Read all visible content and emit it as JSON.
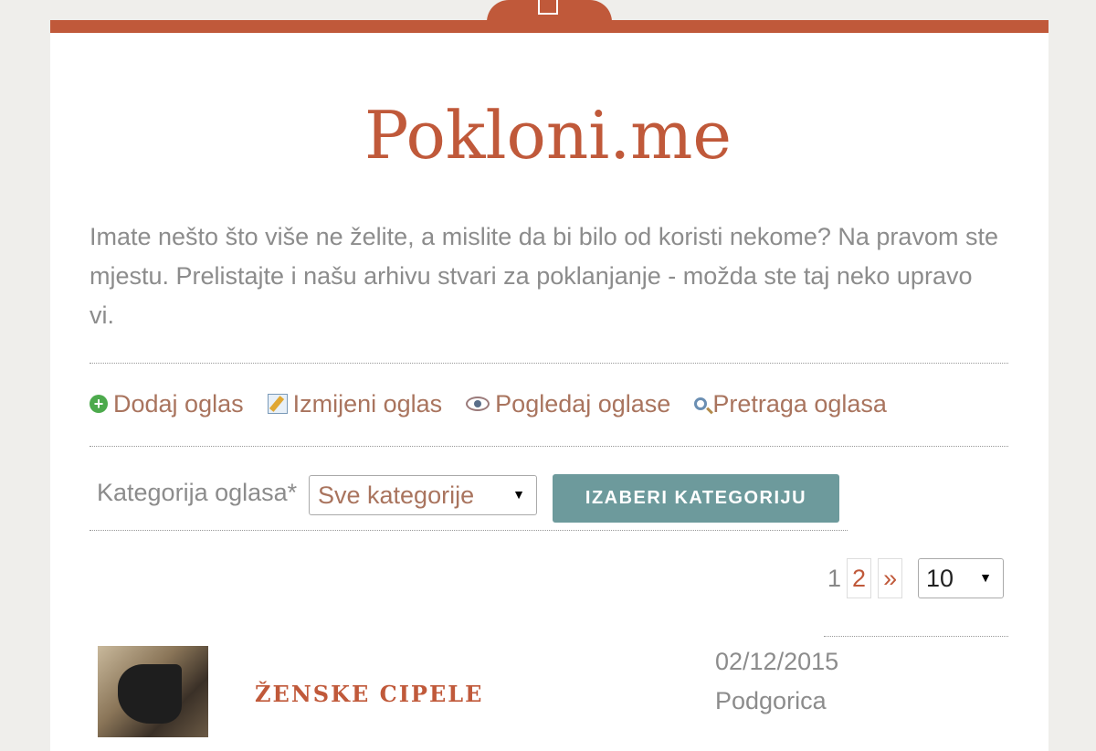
{
  "site": {
    "title": "Pokloni.me",
    "intro": "Imate nešto što više ne želite, a mislite da bi bilo od koristi nekome? Na pravom ste mjestu. Prelistajte i našu arhivu stvari za poklanjanje - možda ste taj neko upravo vi.",
    "accent_color": "#c0593a",
    "button_color": "#6d9a9c"
  },
  "nav": {
    "items": [
      {
        "label": "Dodaj oglas",
        "icon": "add-icon"
      },
      {
        "label": "Izmijeni oglas",
        "icon": "edit-icon"
      },
      {
        "label": "Pogledaj oglase",
        "icon": "eye-icon"
      },
      {
        "label": "Pretraga oglasa",
        "icon": "search-icon"
      }
    ]
  },
  "category_filter": {
    "label": "Kategorija oglasa*",
    "selected": "Sve kategorije",
    "button_label": "IZABERI KATEGORIJU"
  },
  "pagination": {
    "current": "1",
    "next_page": "2",
    "next_label": "»",
    "per_page": "10"
  },
  "listing": {
    "title": "ŽENSKE CIPELE",
    "date": "02/12/2015",
    "city": "Podgorica"
  }
}
